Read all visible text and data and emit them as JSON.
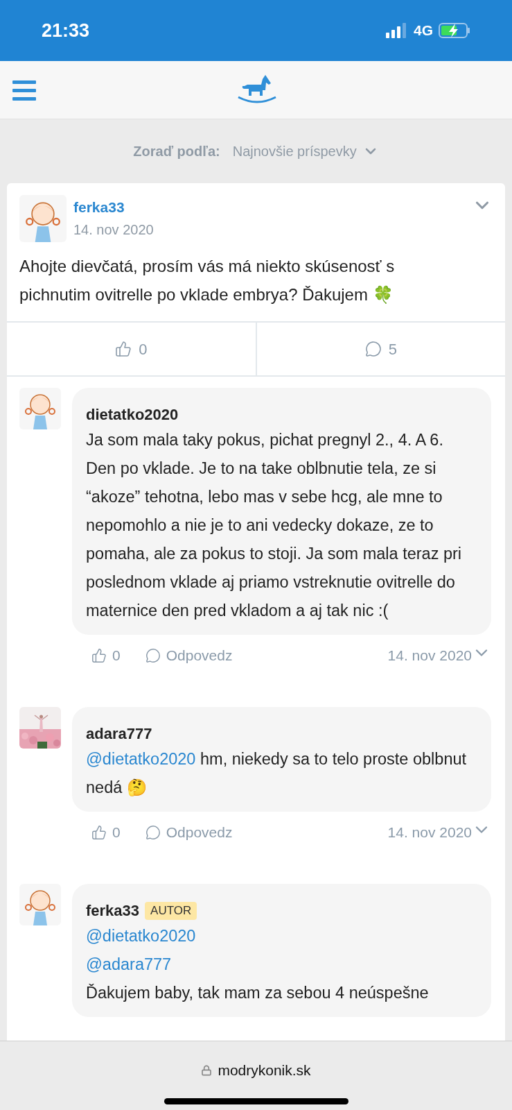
{
  "status_bar": {
    "time": "21:33",
    "network": "4G"
  },
  "sort": {
    "label": "Zoraď podľa:",
    "value": "Najnovšie príspevky"
  },
  "post": {
    "author": "ferka33",
    "date": "14. nov 2020",
    "text": "Ahojte dievčatá, prosím vás má niekto skúsenosť s pichnutim ovitrelle po vklade embrya? Ďakujem 🍀",
    "likes": "0",
    "comments": "5"
  },
  "comments": [
    {
      "author": "dietatko2020",
      "avatar": {
        "kind": "illustration"
      },
      "kind": "plain",
      "text": "Ja som mala taky pokus, pichat pregnyl 2., 4. A 6. Den po vklade. Je to na take oblbnutie tela, ze si “akoze” tehotna, lebo mas v sebe hcg, ale mne to nepomohlo a nie je to ani vedecky dokaze, ze to pomaha, ale za pokus to stoji. Ja som mala teraz pri poslednom vklade aj priamo vstreknutie ovitrelle do maternice den pred vkladom a aj tak nic :(",
      "actions": {
        "likes": "0",
        "reply": "Odpovedz",
        "date": "14. nov 2020"
      }
    },
    {
      "author": "adara777",
      "avatar": {
        "kind": "picture"
      },
      "kind": "inline_mention",
      "mentions": [
        "@dietatko2020"
      ],
      "text": "hm, niekedy sa to telo proste oblbnut nedá 🤔",
      "actions": {
        "likes": "0",
        "reply": "Odpovedz",
        "date": "14. nov 2020"
      }
    },
    {
      "author": "ferka33",
      "avatar": {
        "kind": "illustration"
      },
      "badge": "AUTOR",
      "kind": "stacked_mention",
      "mentions": [
        "@dietatko2020",
        "@adara777"
      ],
      "text": "Ďakujem baby, tak mam za sebou 4 neúspešne"
    }
  ],
  "browser_bar": {
    "url": "modrykonik.sk"
  }
}
